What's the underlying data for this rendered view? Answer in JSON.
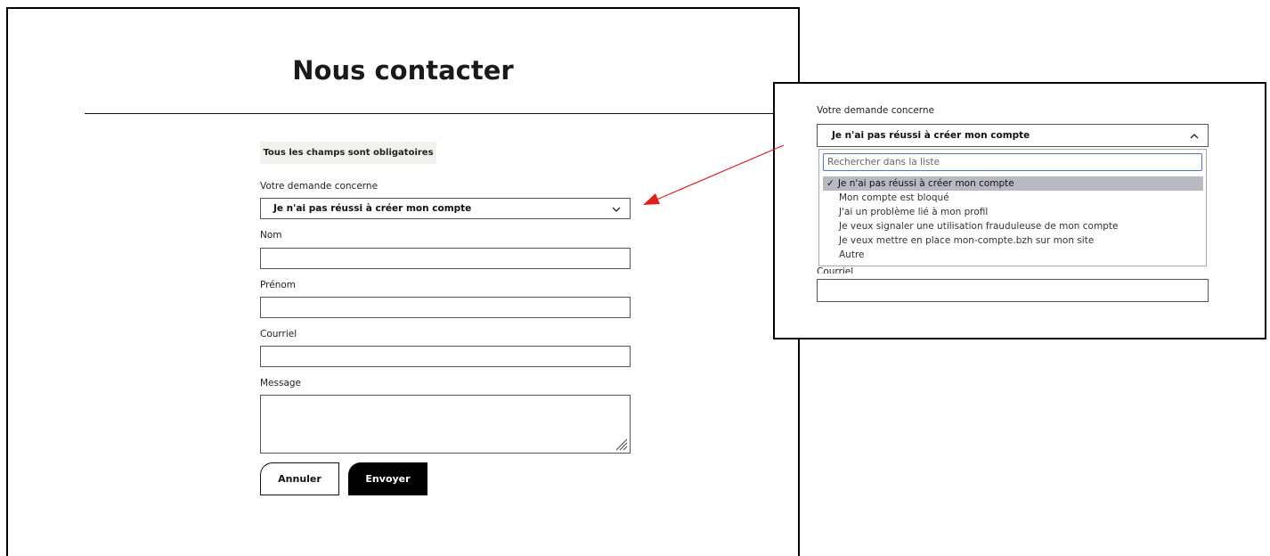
{
  "main": {
    "title": "Nous contacter",
    "notice": "Tous les champs sont obligatoires",
    "subject_label": "Votre demande concerne",
    "subject_value": "Je n'ai pas réussi à créer mon compte",
    "nom_label": "Nom",
    "prenom_label": "Prénom",
    "courriel_label": "Courriel",
    "message_label": "Message",
    "cancel_label": "Annuler",
    "send_label": "Envoyer"
  },
  "zoom": {
    "subject_label": "Votre demande concerne",
    "subject_value": "Je n'ai pas réussi à créer mon compte",
    "search_placeholder": "Rechercher dans la liste",
    "options": [
      {
        "label": "Je n'ai pas réussi à créer mon compte",
        "selected": true
      },
      {
        "label": "Mon compte est bloqué",
        "selected": false
      },
      {
        "label": "J'ai un problème lié à mon profil",
        "selected": false
      },
      {
        "label": "Je veux signaler une utilisation frauduleuse de mon compte",
        "selected": false
      },
      {
        "label": "Je veux mettre en place mon-compte.bzh sur mon site",
        "selected": false
      },
      {
        "label": "Autre",
        "selected": false
      }
    ],
    "checkmark": "✓",
    "next_label": "Courriel"
  },
  "colors": {
    "arrow": "#e02020",
    "selected_option_bg": "#b7bac0",
    "search_border": "#4a78c2",
    "notice_bg": "#f3f1ed"
  },
  "icons": {
    "chevron_down": "chevron-down-icon",
    "chevron_up": "chevron-up-icon",
    "resize_grip": "resize-grip-icon"
  }
}
